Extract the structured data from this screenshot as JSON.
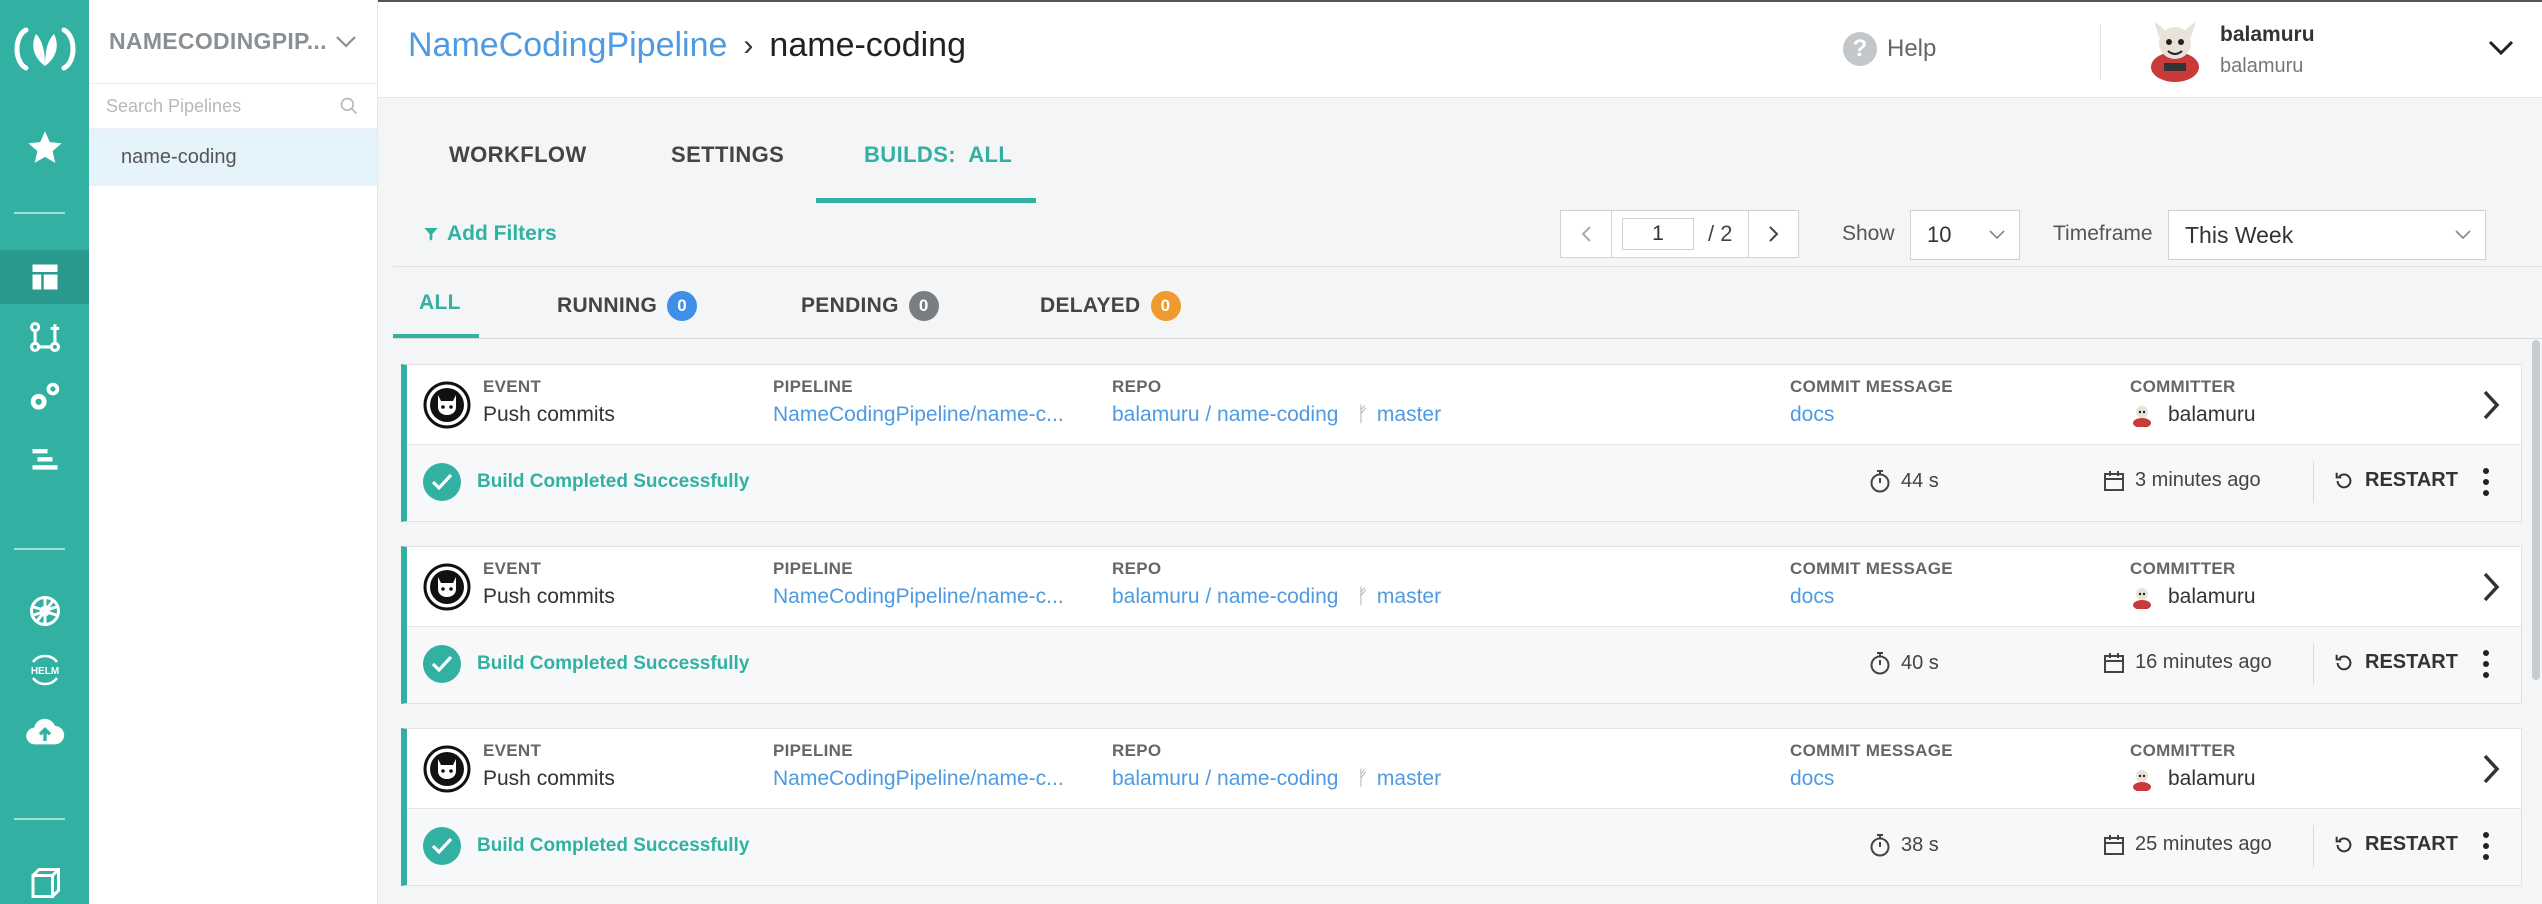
{
  "rail": {
    "items": [
      {
        "icon": "codefresh-logo-icon"
      },
      {
        "icon": "star-icon"
      },
      {
        "icon": "dashboard-icon"
      },
      {
        "icon": "pipelines-icon"
      },
      {
        "icon": "settings-gears-icon"
      },
      {
        "icon": "builds-list-icon"
      },
      {
        "icon": "kubernetes-icon"
      },
      {
        "icon": "helm-icon",
        "label": "HELM"
      },
      {
        "icon": "cloud-upload-icon"
      },
      {
        "icon": "cube-icon"
      }
    ]
  },
  "sidebar": {
    "title": "NAMECODINGPIP...",
    "search_placeholder": "Search Pipelines",
    "items": [
      {
        "label": "name-coding"
      }
    ]
  },
  "header": {
    "breadcrumb_project": "NameCodingPipeline",
    "breadcrumb_separator": "›",
    "breadcrumb_pipeline": "name-coding",
    "help": "Help",
    "user_name": "balamuru",
    "user_account": "balamuru"
  },
  "tabs": [
    {
      "label": "WORKFLOW"
    },
    {
      "label": "SETTINGS"
    },
    {
      "label": "BUILDS:  ALL",
      "active": true
    }
  ],
  "filters": {
    "add_filters": "Add Filters",
    "page_current": "1",
    "page_total": "/  2",
    "show_label": "Show",
    "show_value": "10",
    "timeframe_label": "Timeframe",
    "timeframe_value": "This Week"
  },
  "status_tabs": [
    {
      "label": "ALL",
      "active": true
    },
    {
      "label": "RUNNING",
      "count": "0",
      "color": "#3f8fe8"
    },
    {
      "label": "PENDING",
      "count": "0",
      "color": "#7b7e81"
    },
    {
      "label": "DELAYED",
      "count": "0",
      "color": "#ef9a2e"
    }
  ],
  "columns": {
    "event": "EVENT",
    "pipeline": "PIPELINE",
    "repo": "REPO",
    "commit_message": "COMMIT MESSAGE",
    "committer": "COMMITTER"
  },
  "builds": [
    {
      "event": "Push commits",
      "pipeline": "NameCodingPipeline/name-c...",
      "repo": "balamuru / name-coding",
      "branch": "master",
      "commit_message": "docs",
      "committer": "balamuru",
      "status": "Build Completed Successfully",
      "duration": "44 s",
      "finished": "3 minutes ago",
      "restart": "RESTART"
    },
    {
      "event": "Push commits",
      "pipeline": "NameCodingPipeline/name-c...",
      "repo": "balamuru / name-coding",
      "branch": "master",
      "commit_message": "docs",
      "committer": "balamuru",
      "status": "Build Completed Successfully",
      "duration": "40 s",
      "finished": "16 minutes ago",
      "restart": "RESTART"
    },
    {
      "event": "Push commits",
      "pipeline": "NameCodingPipeline/name-c...",
      "repo": "balamuru / name-coding",
      "branch": "master",
      "commit_message": "docs",
      "committer": "balamuru",
      "status": "Build Completed Successfully",
      "duration": "38 s",
      "finished": "25 minutes ago",
      "restart": "RESTART"
    }
  ],
  "colors": {
    "accent": "#32b1a3",
    "link": "#4f9ae0"
  }
}
